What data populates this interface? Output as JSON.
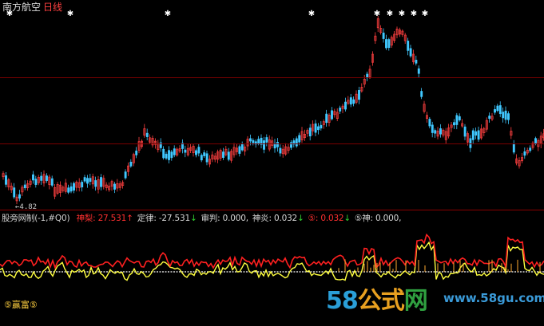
{
  "header": {
    "stock_name": "南方航空",
    "period": "日线"
  },
  "price_chart": {
    "low_label": "4.82",
    "colors": {
      "up": "#ff4040",
      "down": "#40c8ff",
      "grid": "#7a0000"
    }
  },
  "indicator": {
    "name": "股旁网制(-1,#Q0)",
    "items": [
      {
        "label": "神梨:",
        "value": "27.531",
        "arrow": "↑",
        "label_color": "red",
        "value_color": "red"
      },
      {
        "label": "定律:",
        "value": "-27.531",
        "arrow": "↓",
        "label_color": "wht",
        "value_color": "wht"
      },
      {
        "label": "审判:",
        "value": "0.000,",
        "arrow": "",
        "label_color": "wht",
        "value_color": "wht"
      },
      {
        "label": "神炎:",
        "value": "0.032",
        "arrow": "↓",
        "label_color": "wht",
        "value_color": "wht"
      },
      {
        "label": "⑤:",
        "value": "0.032",
        "arrow": "↓",
        "label_color": "red",
        "value_color": "red"
      },
      {
        "label": "⑤神:",
        "value": "0.000,",
        "arrow": "",
        "label_color": "wht",
        "value_color": "wht"
      }
    ],
    "colors": {
      "series_red": "#ff2020",
      "series_yellow": "#ffff40",
      "baseline": "#ffffff"
    }
  },
  "branding": {
    "label": "⑤赢富⑤"
  },
  "watermark": {
    "p1": "58",
    "p2": "公式",
    "p3": "网",
    "url": "www.58gu.com"
  }
}
